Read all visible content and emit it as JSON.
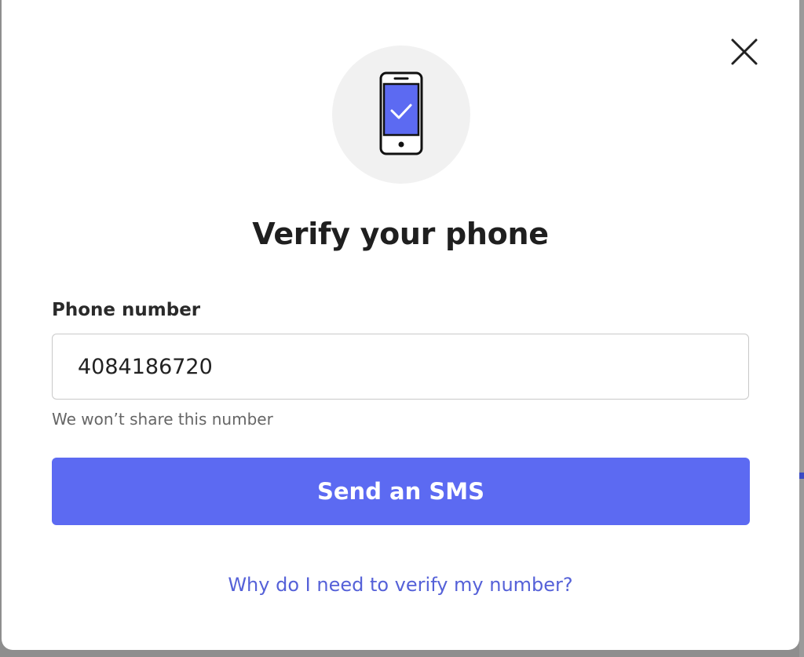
{
  "dialog": {
    "title": "Verify your phone",
    "close_icon": "close-icon",
    "hero_icon": "phone-check-icon"
  },
  "form": {
    "phone_label": "Phone number",
    "phone_value": "4084186720",
    "hint": "We won’t share this number"
  },
  "actions": {
    "send_label": "Send an SMS",
    "why_link": "Why do I need to verify my number?"
  },
  "colors": {
    "accent": "#5c6af2",
    "link": "#5561d8",
    "hero_bg": "#f1f1f1"
  }
}
